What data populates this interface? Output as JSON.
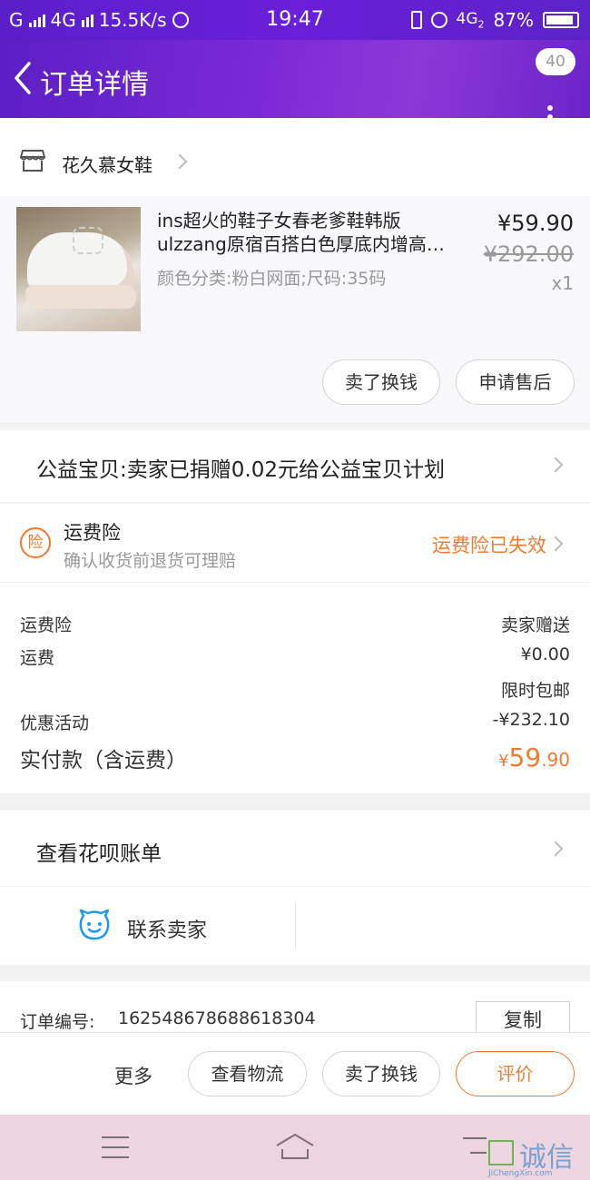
{
  "status_bar": {
    "carrier1": "G",
    "net": "4G",
    "speed": "15.5K/s",
    "time": "19:47",
    "net2": "4G",
    "net2_sub": "2",
    "battery": "87%"
  },
  "nav": {
    "title": "订单详情",
    "badge": "40"
  },
  "shop": {
    "name": "花久慕女鞋"
  },
  "item": {
    "title_line1": "ins超火的鞋子女春老爹鞋韩版",
    "title_line2": "ulzzang原宿百搭白色厚底内增高…",
    "spec": "颜色分类:粉白网面;尺码:35码",
    "price": "¥59.90",
    "original_price": "¥292.00",
    "quantity": "x1",
    "btn_resell": "卖了换钱",
    "btn_aftersale": "申请售后"
  },
  "charity": {
    "text": "公益宝贝:卖家已捐赠0.02元给公益宝贝计划"
  },
  "insurance": {
    "icon_char": "险",
    "title": "运费险",
    "subtitle": "确认收货前退货可理赔",
    "status": "运费险已失效",
    "status_color": "#f07a32"
  },
  "fees": {
    "rows": [
      {
        "label": "运费险",
        "value": "卖家赠送"
      },
      {
        "label": "运费",
        "value": "¥0.00"
      },
      {
        "label": "",
        "value": "限时包邮"
      },
      {
        "label": "优惠活动",
        "value": "-¥232.10"
      }
    ],
    "paid_label": "实付款（含运费）",
    "paid_currency": "¥",
    "paid_int": "59",
    "paid_dec": ".90"
  },
  "huabei": {
    "text": "查看花呗账单"
  },
  "contact": {
    "text": "联系卖家",
    "icon_color": "#1e9be8"
  },
  "order": {
    "label": "订单编号:",
    "number": "162548678688618304",
    "copy": "复制"
  },
  "actions": {
    "more": "更多",
    "logistics": "查看物流",
    "resell": "卖了换钱",
    "review": "评价"
  },
  "watermark": {
    "text": "诚信",
    "sub": "JiChengXin.com"
  }
}
